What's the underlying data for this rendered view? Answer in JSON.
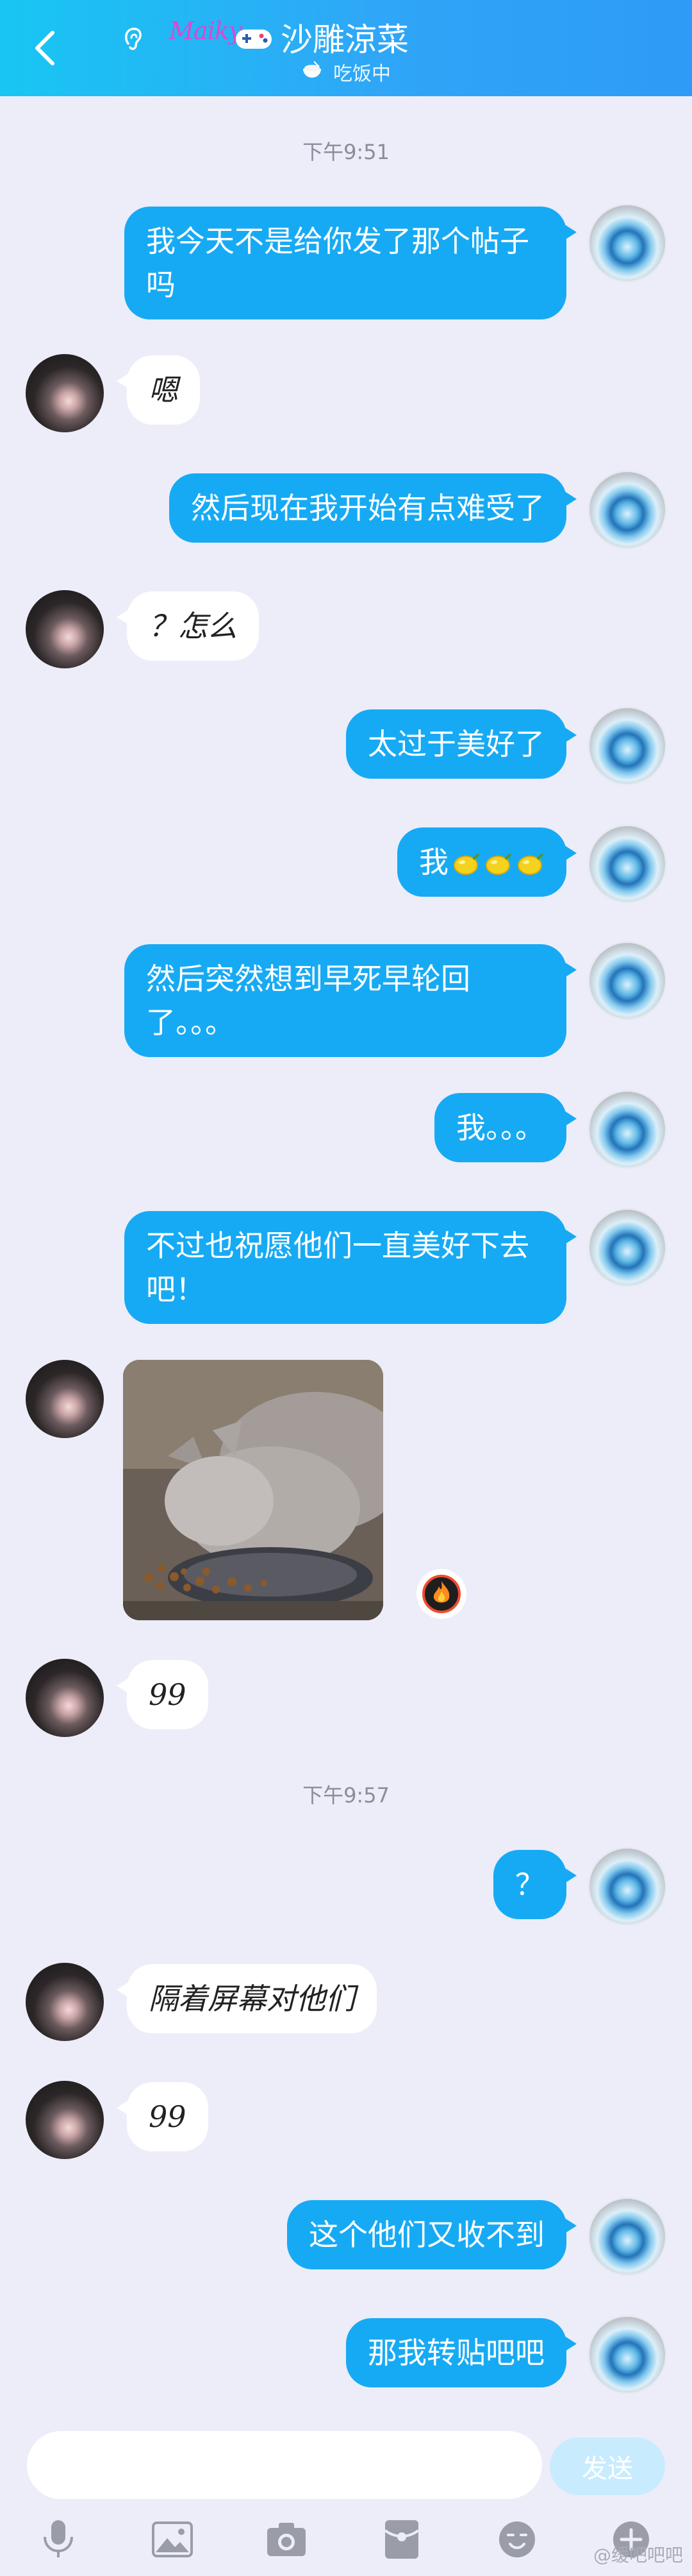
{
  "header": {
    "logo_text": "Maiky",
    "title": "沙雕涼菜",
    "status": "吃饭中"
  },
  "timestamps": [
    "下午9:51",
    "下午9:57"
  ],
  "messages": [
    {
      "side": "out",
      "text": "我今天不是给你发了那个帖子吗"
    },
    {
      "side": "in",
      "text": "嗯"
    },
    {
      "side": "out",
      "text": "然后现在我开始有点难受了"
    },
    {
      "side": "in",
      "text": "？怎么"
    },
    {
      "side": "out",
      "text": "太过于美好了"
    },
    {
      "side": "out",
      "text": "我",
      "emoji": [
        "lemon",
        "lemon",
        "lemon"
      ]
    },
    {
      "side": "out",
      "text": "然后突然想到早死早轮回了。。。"
    },
    {
      "side": "out",
      "text": "我。。。"
    },
    {
      "side": "out",
      "text": "不过也祝愿他们一直美好下去吧！"
    },
    {
      "side": "in",
      "type": "image",
      "image": "cat-eating-photo",
      "reaction_icon": "fire-badge-icon"
    },
    {
      "side": "in",
      "text": "99"
    },
    {
      "side": "out",
      "text": "？"
    },
    {
      "side": "in",
      "text": "隔着屏幕对他们"
    },
    {
      "side": "in",
      "text": "99"
    },
    {
      "side": "out",
      "text": "这个他们又收不到"
    },
    {
      "side": "out",
      "text": "那我转贴吧吧"
    }
  ],
  "input": {
    "placeholder": "",
    "send_label": "发送"
  },
  "toolbar": [
    "mic-icon",
    "image-icon",
    "camera-icon",
    "red-packet-icon",
    "emoji-icon",
    "plus-icon"
  ],
  "watermark": "@缓吧吧吧",
  "colors": {
    "header_start": "#18C6F3",
    "header_end": "#2E9BF6",
    "bubble_out": "#17AAF4",
    "bubble_in": "#FFFFFF",
    "background": "#ECEDF8",
    "send_disabled": "#C8ECFE"
  }
}
